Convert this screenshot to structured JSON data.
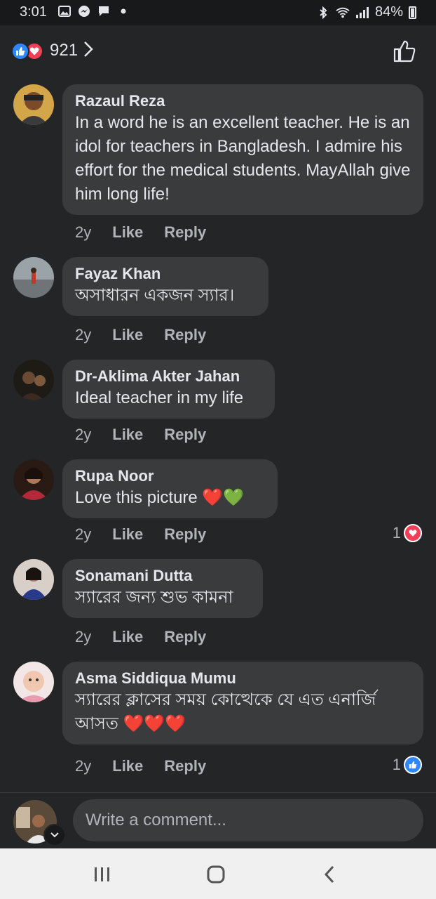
{
  "status_bar": {
    "time": "3:01",
    "battery": "84%"
  },
  "reactions": {
    "count": "921"
  },
  "comments": [
    {
      "name": "Razaul Reza",
      "text": "In a word he is an excellent teacher. He is an idol for teachers in Bangladesh. I admire his effort for the medical students.  MayAllah give him long life!",
      "time": "2y",
      "like": "Like",
      "reply": "Reply"
    },
    {
      "name": "Fayaz Khan",
      "text": "অসাধারন একজন স্যার।",
      "time": "2y",
      "like": "Like",
      "reply": "Reply"
    },
    {
      "name": "Dr-Aklima Akter Jahan",
      "text": "Ideal teacher in my life",
      "time": "2y",
      "like": "Like",
      "reply": "Reply"
    },
    {
      "name": "Rupa Noor",
      "text": "Love this picture ❤️💚",
      "time": "2y",
      "like": "Like",
      "reply": "Reply",
      "reaction_count": "1",
      "reaction_icon": "love-icon"
    },
    {
      "name": "Sonamani Dutta",
      "text": "স্যারের জন্য শুভ কামনা",
      "time": "2y",
      "like": "Like",
      "reply": "Reply"
    },
    {
      "name": "Asma Siddiqua Mumu",
      "text": "স্যারের ক্লাসের সময় কোত্থেকে যে এত এনার্জি আসত ❤️❤️❤️",
      "time": "2y",
      "like": "Like",
      "reply": "Reply",
      "reaction_count": "1",
      "reaction_icon": "like-icon"
    }
  ],
  "composer": {
    "placeholder": "Write a comment..."
  },
  "colors": {
    "background": "#242526",
    "bubble": "#3a3b3c",
    "like_blue": "#2d88ff",
    "love_red": "#f33e58"
  }
}
